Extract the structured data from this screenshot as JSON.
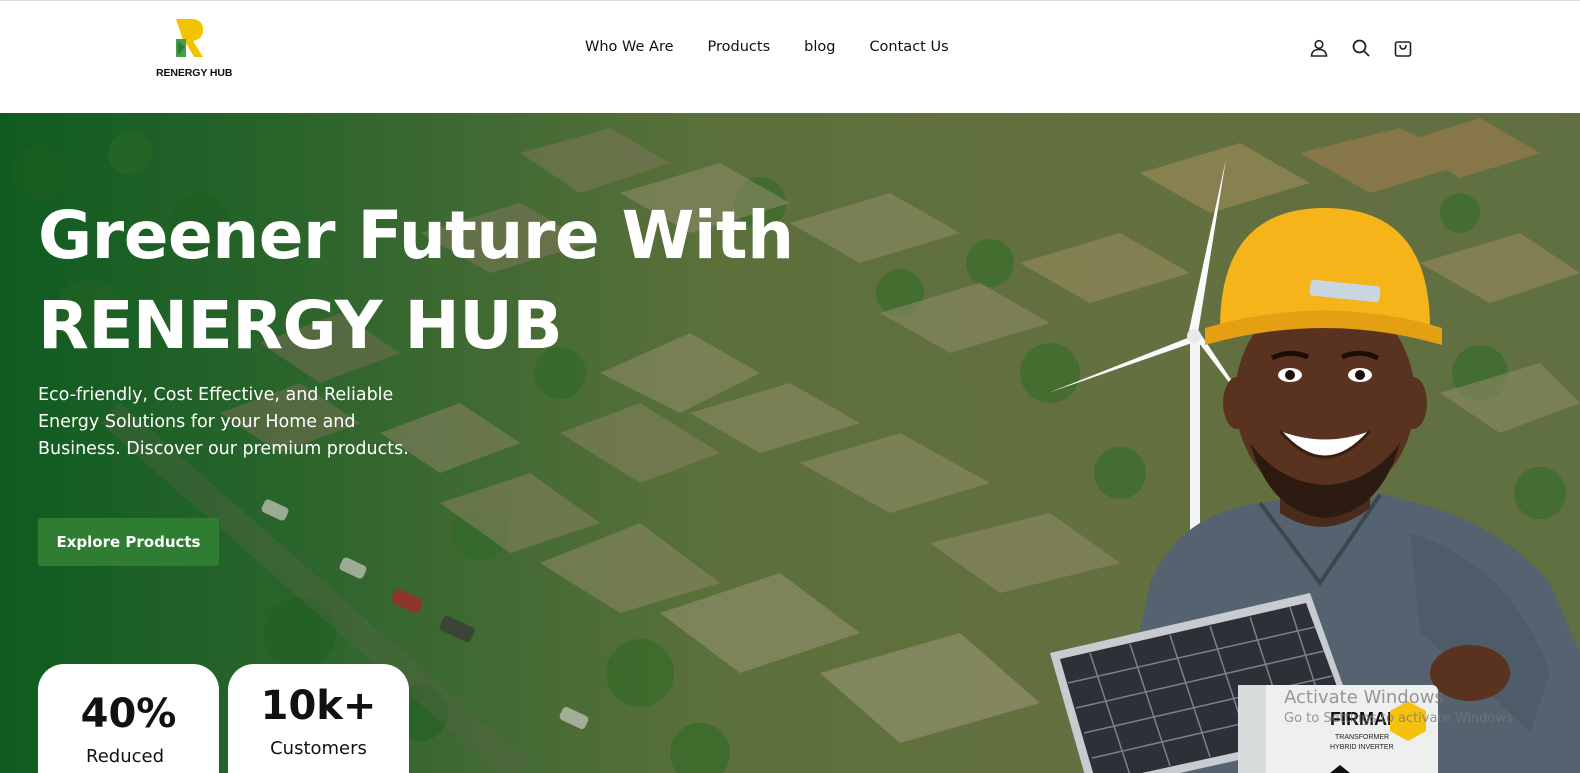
{
  "brand": {
    "name": "RENERGY HUB"
  },
  "nav": {
    "items": [
      "Who We Are",
      "Products",
      "blog",
      "Contact Us"
    ]
  },
  "header_icons": [
    "user-icon",
    "search-icon",
    "cart-icon"
  ],
  "hero": {
    "title_line1": "Greener Future With",
    "title_line2": "RENERGY HUB",
    "subtitle": "Eco-friendly, Cost Effective, and Reliable Energy Solutions for your Home and Business. Discover our premium products.",
    "cta_label": "Explore Products"
  },
  "stats": [
    {
      "value": "40%",
      "label": "Reduced"
    },
    {
      "value": "10k+",
      "label": "Customers"
    }
  ],
  "product_box": {
    "brand": "FIRMAN",
    "line1": "TRANSFORMER",
    "line2": "HYBRID INVERTER"
  },
  "watermark": {
    "line1": "Activate Windows",
    "line2": "Go to Settings to activate Windows."
  },
  "colors": {
    "brand_green": "#2e7d32",
    "logo_yellow": "#f2c300",
    "helmet": "#f4b41a"
  }
}
